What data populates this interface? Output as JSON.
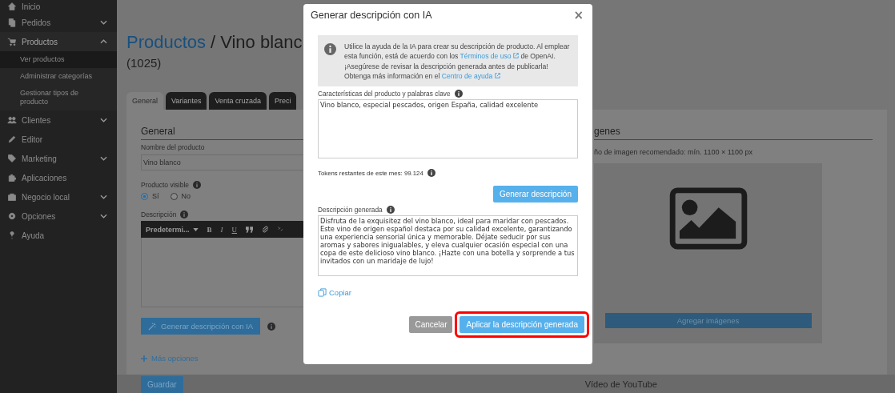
{
  "sidebar": {
    "items": [
      {
        "label": "Inicio",
        "kind": "link"
      },
      {
        "label": "Pedidos",
        "kind": "group",
        "expanded": false
      },
      {
        "label": "Productos",
        "kind": "group",
        "expanded": true,
        "children": [
          {
            "label": "Ver productos",
            "selected": true
          },
          {
            "label": "Administrar categorías",
            "selected": false
          },
          {
            "label": "Gestionar tipos de producto",
            "selected": false
          }
        ]
      },
      {
        "label": "Clientes",
        "kind": "group",
        "expanded": false
      },
      {
        "label": "Editor",
        "kind": "link"
      },
      {
        "label": "Marketing",
        "kind": "group",
        "expanded": false
      },
      {
        "label": "Aplicaciones",
        "kind": "link"
      },
      {
        "label": "Negocio local",
        "kind": "group",
        "expanded": false
      },
      {
        "label": "Opciones",
        "kind": "group",
        "expanded": false
      },
      {
        "label": "Ayuda",
        "kind": "link"
      }
    ]
  },
  "page": {
    "breadcrumb_link": "Productos",
    "separator": "/",
    "title": "Vino blanc",
    "product_id": "(1025)"
  },
  "tabs": [
    {
      "label": "General",
      "selected": true
    },
    {
      "label": "Variantes",
      "selected": false
    },
    {
      "label": "Venta cruzada",
      "selected": false
    },
    {
      "label": "Preci",
      "selected": false
    }
  ],
  "general": {
    "heading": "General",
    "name_label": "Nombre del producto",
    "name_value": "Vino blanco",
    "visible_label": "Producto visible",
    "visibility_options": [
      {
        "label": "Sí",
        "selected": true
      },
      {
        "label": "No",
        "selected": false
      }
    ],
    "description_label": "Descripción",
    "editor": {
      "format": "Predetermi...",
      "tools": [
        "B",
        "I",
        "U"
      ]
    },
    "ai_button": "Generar descripción con IA",
    "more_options": "Más opciones"
  },
  "images": {
    "heading": "genes",
    "hint": "ño de imagen recomendado: mín. 1100 × 1100 px",
    "add_button": "Agregar imágenes"
  },
  "video_heading": "Vídeo de YouTube",
  "save_button": "Guardar",
  "modal": {
    "title": "Generar descripción con IA",
    "close": "×",
    "info": [
      {
        "parts": [
          {
            "text": "Utilice la ayuda de la IA para crear su descripción de producto. Al emplear esta función, está de acuerdo con los "
          },
          {
            "text": "Términos de uso",
            "link": true
          },
          {
            "text": " de OpenAI."
          }
        ]
      },
      {
        "parts": [
          {
            "text": "¡Asegúrese de revisar la descripción generada antes de publicarla! Obtenga más información en el "
          },
          {
            "text": "Centro de ayuda",
            "link": true
          }
        ]
      }
    ],
    "keywords_label": "Características del producto y palabras clave",
    "keywords_value": "Vino blanco, especial pescados, origen España, calidad excelente",
    "tokens": "Tokens restantes de este mes: 99.124",
    "generate_button": "Generar descripción",
    "generated_label": "Descripción generada",
    "generated_value": "Disfruta de la exquisitez del vino blanco, ideal para maridar con pescados. Este vino de origen español destaca por su calidad excelente, garantizando una experiencia sensorial única y memorable. Déjate seducir por sus aromas y sabores inigualables, y eleva cualquier ocasión especial con una copa de este delicioso vino blanco. ¡Hazte con una botella y sorprende a tus invitados con un maridaje de lujo!",
    "copy_link": "Copiar",
    "cancel_button": "Cancelar",
    "apply_button": "Aplicar la descripción generada",
    "apply_highlighted": true
  }
}
